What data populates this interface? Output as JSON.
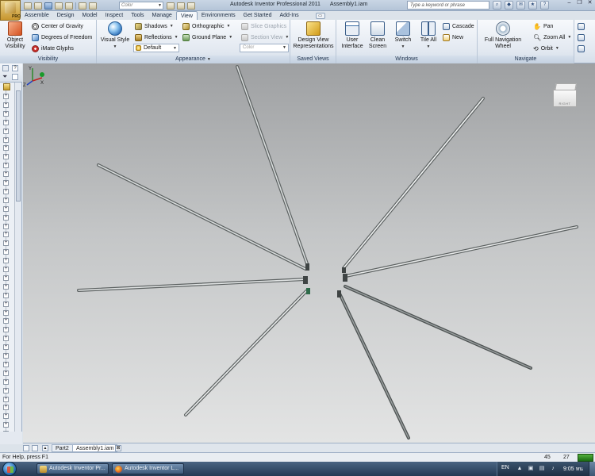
{
  "window": {
    "app_title": "Autodesk Inventor Professional 2011",
    "doc_title": "Assembly1.iam",
    "app_badge": "PRO",
    "color_combo": "Color",
    "search_placeholder": "Type a keyword or phrase",
    "tools": [
      "?"
    ]
  },
  "tabs": [
    "Assemble",
    "Design",
    "Model",
    "Inspect",
    "Tools",
    "Manage",
    "View",
    "Environments",
    "Get Started",
    "Add-Ins"
  ],
  "active_tab": "View",
  "ribbon": {
    "visibility": {
      "title": "Visibility",
      "object_visibility": "Object Visibility",
      "center_of_gravity": "Center of Gravity",
      "degrees_of_freedom": "Degrees of Freedom",
      "imate_glyphs": "iMate Glyphs"
    },
    "appearance": {
      "title": "Appearance",
      "visual_style": "Visual Style",
      "shadows": "Shadows",
      "reflections": "Reflections",
      "default": "Default",
      "orthographic": "Orthographic",
      "ground_plane": "Ground Plane",
      "slice_graphics": "Slice Graphics",
      "section_view": "Section View",
      "color_combo": "Color"
    },
    "saved_views": {
      "title": "Saved Views",
      "design_view": "Design View Representations"
    },
    "windows": {
      "title": "Windows",
      "user_interface": "User Interface",
      "clean_screen": "Clean Screen",
      "switch": "Switch",
      "tile_all": "Tile All",
      "cascade": "Cascade",
      "new": "New"
    },
    "navigate": {
      "title": "Navigate",
      "full_nav_wheel": "Full Navigation Wheel",
      "pan": "Pan",
      "zoom_all": "Zoom All",
      "orbit": "Orbit"
    }
  },
  "viewcube": {
    "face_label": "RIGHT"
  },
  "triad": {
    "x": "X",
    "y": "Y",
    "z": "Z"
  },
  "doc_tabs": [
    "Part2",
    "Assembly1.iam"
  ],
  "active_doc_tab": "Assembly1.iam",
  "status": {
    "help_text": "For Help, press F1",
    "count1": "45",
    "count2": "27"
  },
  "taskbar": {
    "tasks": [
      "Autodesk Inventor Pr...",
      "Autodesk Inventor L..."
    ],
    "lang": "EN",
    "time": "9:05 หน"
  },
  "colors": {
    "viewport_top": "#9ea0a2",
    "viewport_bottom": "#e3e4e4",
    "rod": "#c9cdcd",
    "accent_green": "#1a7a26"
  }
}
